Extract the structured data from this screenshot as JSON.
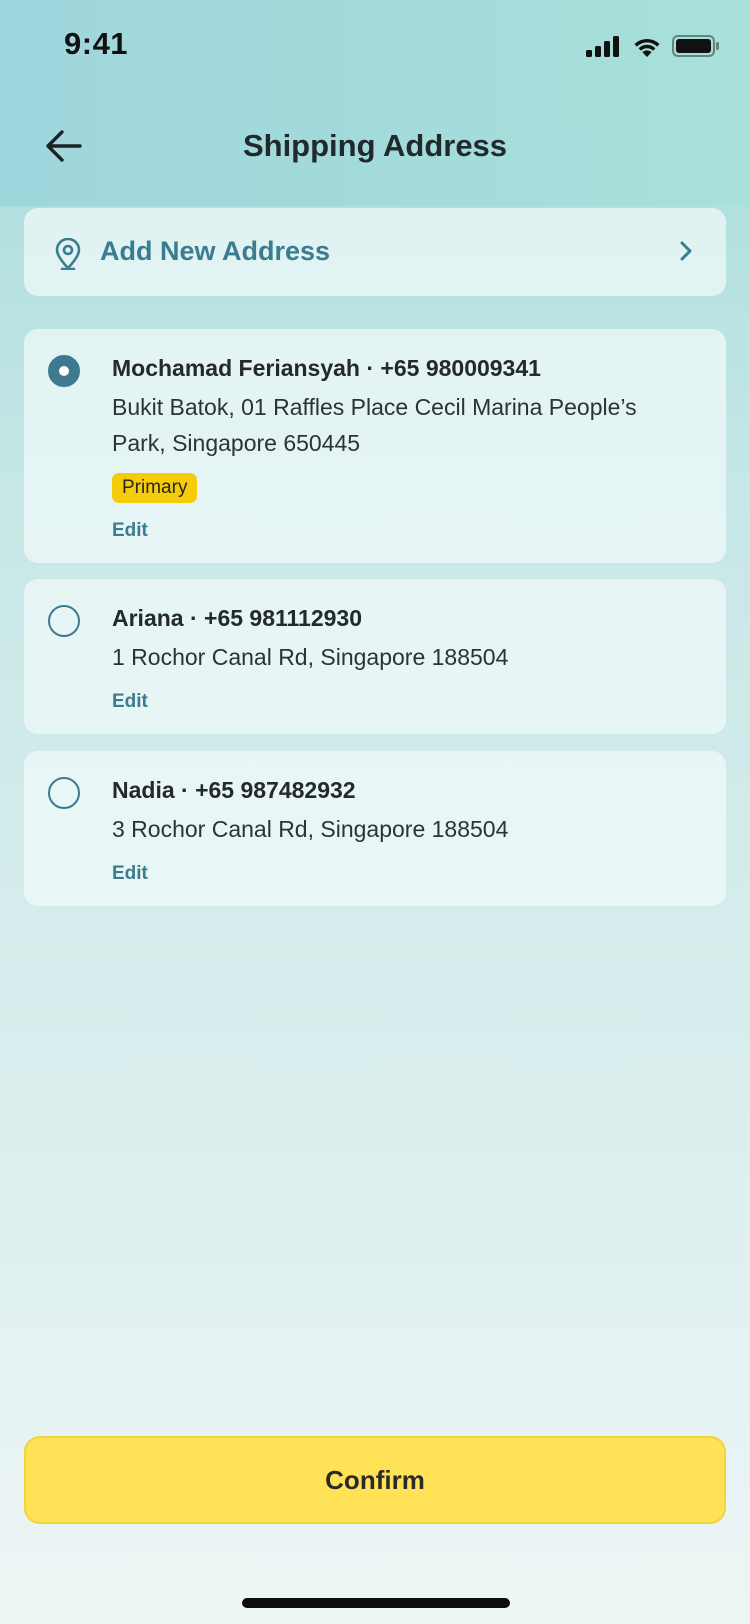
{
  "status_bar": {
    "time": "9:41",
    "icons": [
      "cellular-signal-icon",
      "wifi-icon",
      "battery-icon"
    ]
  },
  "nav": {
    "back_icon": "arrow-left-icon",
    "title": "Shipping Address"
  },
  "add_address": {
    "icon": "location-pin-icon",
    "label": "Add New Address",
    "chevron_icon": "chevron-right-icon"
  },
  "addresses": [
    {
      "name_phone": "Mochamad Feriansyah · +65 980009341",
      "address": "Bukit Batok, 01 Raffles Place Cecil Marina People’s Park, Singapore 650445",
      "badge": "Primary",
      "edit_label": "Edit",
      "selected": true
    },
    {
      "name_phone": "Ariana · +65 981112930",
      "address": "1 Rochor Canal Rd, Singapore 188504",
      "edit_label": "Edit",
      "selected": false
    },
    {
      "name_phone": "Nadia · +65 987482932",
      "address": "3 Rochor Canal Rd, Singapore 188504",
      "edit_label": "Edit",
      "selected": false
    }
  ],
  "confirm_button": {
    "label": "Confirm"
  },
  "colors": {
    "accent": "#3a7c90",
    "badge": "#f5cc0a",
    "confirm": "#ffe256"
  }
}
